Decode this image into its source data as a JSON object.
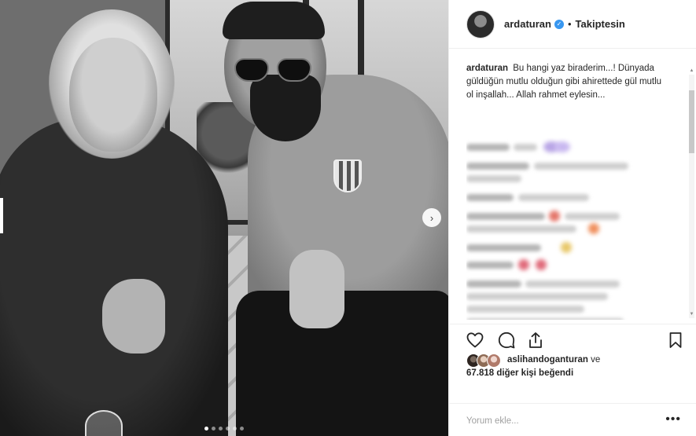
{
  "post": {
    "username": "ardaturan",
    "follow_status": "Takiptesin",
    "separator": "•",
    "verified_mark": "✓"
  },
  "caption": {
    "username": "ardaturan",
    "text": "Bu hangi yaz biraderim...! Dünyada güldüğün mutlu olduğun gibi ahirettede gül mutlu ol inşallah... Allah rahmet eylesin..."
  },
  "likes": {
    "first_liker": "aslihandoganturan",
    "connector": "ve",
    "others_text": "67.818 diğer kişi beğendi"
  },
  "add_comment": {
    "placeholder": "Yorum ekle...",
    "more_label": "•••"
  },
  "carousel": {
    "next_arrow": "›",
    "slide_count": 6,
    "active_slide": 1
  },
  "icons": {
    "like": "heart-icon",
    "comment": "comment-bubble-icon",
    "share": "share-icon",
    "save": "bookmark-icon"
  },
  "colors": {
    "verified": "#3897f0",
    "border": "#efefef",
    "text": "#262626",
    "placeholder": "#a0a0a0"
  }
}
